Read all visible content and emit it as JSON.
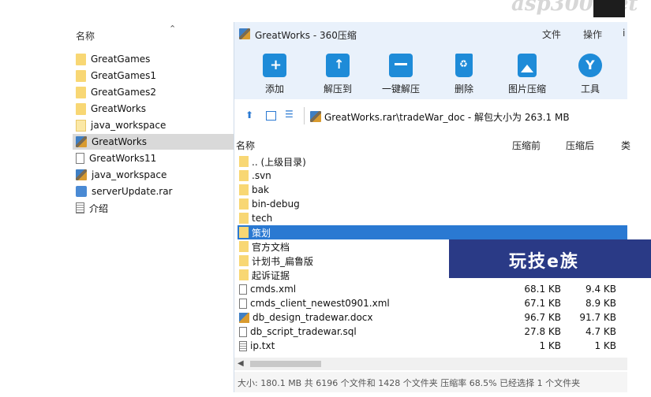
{
  "explorer": {
    "header": "名称",
    "items": [
      {
        "label": "GreatGames",
        "icon": "folder-icon"
      },
      {
        "label": "GreatGames1",
        "icon": "folder-icon"
      },
      {
        "label": "GreatGames2",
        "icon": "folder-icon"
      },
      {
        "label": "GreatWorks",
        "icon": "folder-icon"
      },
      {
        "label": "java_workspace",
        "icon": "folder-icon"
      },
      {
        "label": "GreatWorks",
        "icon": "rar-archive-icon",
        "selected": true
      },
      {
        "label": "GreatWorks11",
        "icon": "document-icon"
      },
      {
        "label": "java_workspace",
        "icon": "rar-archive-icon"
      },
      {
        "label": "serverUpdate.rar",
        "icon": "network-archive-icon"
      },
      {
        "label": "介绍",
        "icon": "text-document-icon"
      }
    ]
  },
  "window": {
    "title": "GreatWorks - 360压缩",
    "menu": [
      "文件",
      "操作",
      "i"
    ],
    "toolbar": [
      {
        "label": "添加",
        "icon": "add-folder-icon"
      },
      {
        "label": "解压到",
        "icon": "extract-folder-icon"
      },
      {
        "label": "一键解压",
        "icon": "one-click-extract-icon"
      },
      {
        "label": "删除",
        "icon": "recycle-bin-icon"
      },
      {
        "label": "图片压缩",
        "icon": "image-compress-icon"
      },
      {
        "label": "工具",
        "icon": "tools-icon"
      }
    ],
    "address": "GreatWorks.rar\\tradeWar_doc - 解包大小为 263.1 MB",
    "columns": {
      "name": "名称",
      "before": "压缩前",
      "after": "压缩后",
      "more": "类"
    },
    "files": [
      {
        "name": ".. (上级目录)",
        "icon": "folder-icon",
        "before": "",
        "after": ""
      },
      {
        "name": ".svn",
        "icon": "folder-icon",
        "before": "",
        "after": ""
      },
      {
        "name": "bak",
        "icon": "folder-icon",
        "before": "",
        "after": ""
      },
      {
        "name": "bin-debug",
        "icon": "folder-icon",
        "before": "",
        "after": ""
      },
      {
        "name": "tech",
        "icon": "folder-icon",
        "before": "",
        "after": ""
      },
      {
        "name": "策划",
        "icon": "folder-icon",
        "before": "",
        "after": "",
        "selected": true
      },
      {
        "name": "官方文档",
        "icon": "folder-icon",
        "before": "",
        "after": ""
      },
      {
        "name": "计划书_扁鲁版",
        "icon": "folder-icon",
        "before": "",
        "after": ""
      },
      {
        "name": "起诉证据",
        "icon": "folder-icon",
        "before": "",
        "after": ""
      },
      {
        "name": "cmds.xml",
        "icon": "xml-file-icon",
        "before": "68.1 KB",
        "after": "9.4 KB"
      },
      {
        "name": "cmds_client_newest0901.xml",
        "icon": "xml-file-icon",
        "before": "67.1 KB",
        "after": "8.9 KB"
      },
      {
        "name": "db_design_tradewar.docx",
        "icon": "docx-file-icon",
        "before": "96.7 KB",
        "after": "91.7 KB"
      },
      {
        "name": "db_script_tradewar.sql",
        "icon": "sql-file-icon",
        "before": "27.8 KB",
        "after": "4.7 KB"
      },
      {
        "name": "ip.txt",
        "icon": "txt-file-icon",
        "before": "1 KB",
        "after": "1 KB"
      }
    ],
    "status": "大小: 180.1 MB 共 6196 个文件和 1428 个文件夹 压缩率 68.5% 已经选择 1 个文件夹"
  },
  "watermarks": {
    "top": "asp300.net",
    "banner": "玩技e族"
  },
  "colors": {
    "selection": "#2a79d2",
    "toolbar_bg": "#e9f1fb",
    "icon_blue": "#1e8bd8",
    "folder": "#f8d774",
    "banner_bg": "#2a3a86"
  }
}
